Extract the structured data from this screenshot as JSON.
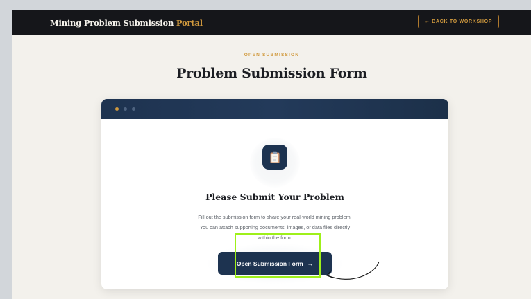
{
  "header": {
    "brand_primary": "Mining Problem Submission",
    "brand_accent": "Portal",
    "back_label": "← BACK TO WORKSHOP"
  },
  "hero": {
    "eyebrow": "OPEN SUBMISSION",
    "title": "Problem Submission Form"
  },
  "card": {
    "icon": "clipboard-icon",
    "title": "Please Submit Your Problem",
    "desc_line1": "Fill out the submission form to share your real-world mining problem.",
    "desc_line2": "You can attach supporting documents, images, or data files directly",
    "desc_line3": "within the form.",
    "cta_label": "Open Submission Form",
    "cta_arrow": "→"
  },
  "colors": {
    "accent": "#d19a3e",
    "navy": "#1d3350",
    "topbar": "#15161a",
    "background": "#f3f1ec",
    "highlight": "#9ef01a"
  }
}
